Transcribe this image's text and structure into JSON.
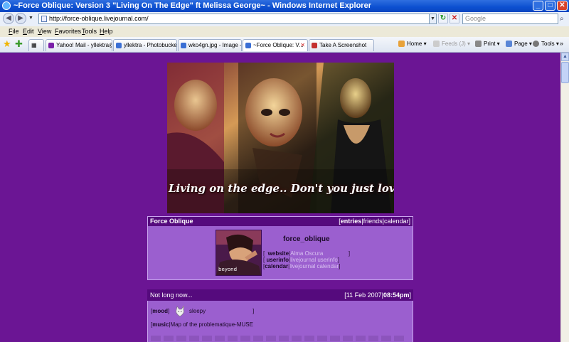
{
  "window": {
    "title": "~Force Oblique: Version 3 \"Living On The Edge\" ft Melissa George~ - Windows Internet Explorer",
    "controls": {
      "minimize": "_",
      "maximize": "□",
      "close": "✕"
    }
  },
  "address_bar": {
    "url": "http://force-oblique.livejournal.com/",
    "search_placeholder": "Google",
    "refresh_glyph": "↻",
    "stop_glyph": "✕",
    "search_glyph": "⌕",
    "dropdown_glyph": "▼"
  },
  "menu": [
    "File",
    "Edit",
    "View",
    "Favorites",
    "Tools",
    "Help"
  ],
  "tabs": [
    {
      "label": "Yahoo! Mail - yllektra@..."
    },
    {
      "label": "yllektra - Photobucket ..."
    },
    {
      "label": "wko4gn.jpg - Image - ..."
    },
    {
      "label": "~Force Oblique: V...",
      "active": true,
      "close": "✕"
    },
    {
      "label": "Take A Screenshot"
    }
  ],
  "command_bar": {
    "home": "Home",
    "feeds": "Feeds (J)",
    "print": "Print",
    "page": "Page",
    "tools": "Tools",
    "chevron": "»"
  },
  "icons": {
    "back": "back-arrow-icon",
    "forward": "forward-arrow-icon",
    "favorites": "favorites-star-icon",
    "add_favorite": "add-favorite-icon"
  },
  "banner": {
    "caption": "Living on the edge.. Don't you just love it",
    "userpic_caption": "beyond"
  },
  "profile": {
    "journal_name": "Force Oblique",
    "nav": {
      "entries": "entries",
      "friends": "friends",
      "calendar": "calendar",
      "sep": "|",
      "lb": "[",
      "rb": "]"
    },
    "username": "force_oblique",
    "links": [
      {
        "label": "website",
        "value": "Alma Oscura"
      },
      {
        "label": "userinfo",
        "value": "livejournal userinfo"
      },
      {
        "label": "calendar",
        "value": "livejournal calendar"
      }
    ]
  },
  "entry": {
    "title": "Not long now...",
    "date": "[11 Feb 2007|",
    "time": "08:54pm",
    "time_close": "]",
    "mood_label": "mood",
    "mood_value": "sleepy",
    "music_label": "music",
    "music_value": "Map of the problematique-MUSE"
  },
  "colors": {
    "page_bg": "#6b1594",
    "panel_bg": "#9b5fcf",
    "header_bg": "#550a7d",
    "titlebar": "#0c4fd0"
  }
}
